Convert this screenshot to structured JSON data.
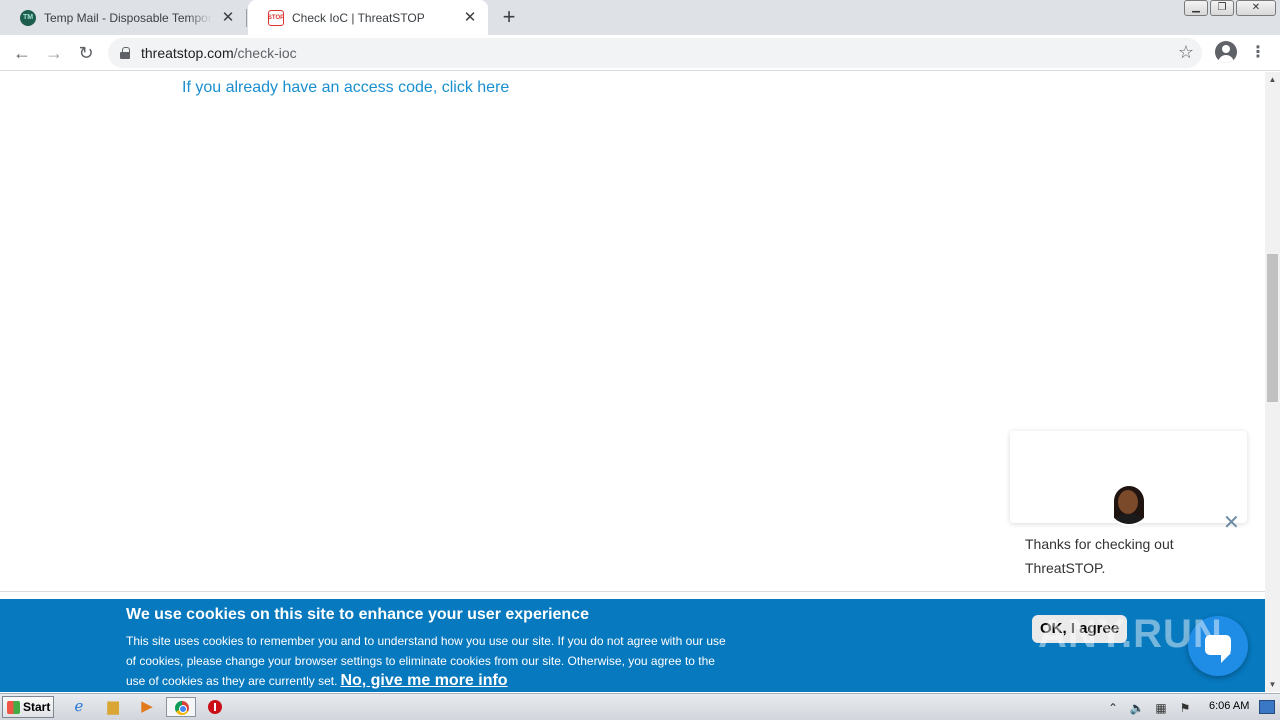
{
  "browser": {
    "tabs": [
      {
        "title": "Temp Mail - Disposable Temporary Email",
        "favicon": "tempmail-favicon",
        "active": false
      },
      {
        "title": "Check IoC | ThreatSTOP",
        "favicon": "threatstop-favicon",
        "active": true
      }
    ],
    "url_host": "threatstop.com",
    "url_path": "/check-ioc"
  },
  "page": {
    "access_link": "If you already have an access code, click here"
  },
  "cookie_banner": {
    "title": "We use cookies on this site to enhance your user experience",
    "body": "This site uses cookies to remember you and to understand how you use our site. If you do not agree with our use of cookies, please change your browser settings to eliminate cookies from our site. Otherwise, you agree to the use of cookies as they are currently set.",
    "more_info_link": "No, give me more info",
    "ok_button": "OK, I agree",
    "background_color": "#0779bf"
  },
  "chat": {
    "message": "Thanks for checking out ThreatSTOP.",
    "launcher_color": "#1f8ce6"
  },
  "watermark": "ANY.RUN",
  "taskbar": {
    "start_label": "Start",
    "clock": "6:06 AM"
  }
}
